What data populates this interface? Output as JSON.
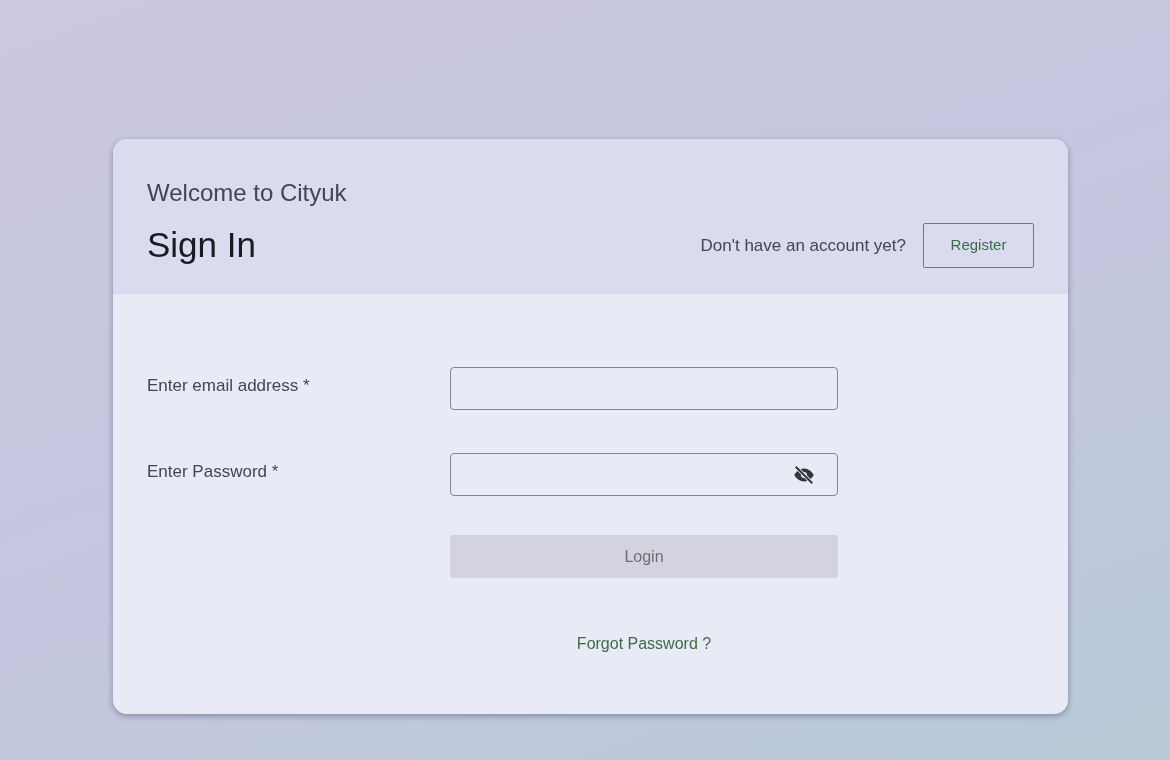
{
  "header": {
    "welcome": "Welcome to Cityuk",
    "title": "Sign In",
    "register_prompt": "Don't have an account yet?",
    "register_button": "Register"
  },
  "fields": [
    {
      "label": "Enter email address *",
      "kind": "email"
    },
    {
      "label": "Enter Password *",
      "kind": "password",
      "visible": false
    }
  ],
  "login_button": {
    "label": "Login",
    "disabled": true
  },
  "forgot_link": "Forgot Password ?"
}
